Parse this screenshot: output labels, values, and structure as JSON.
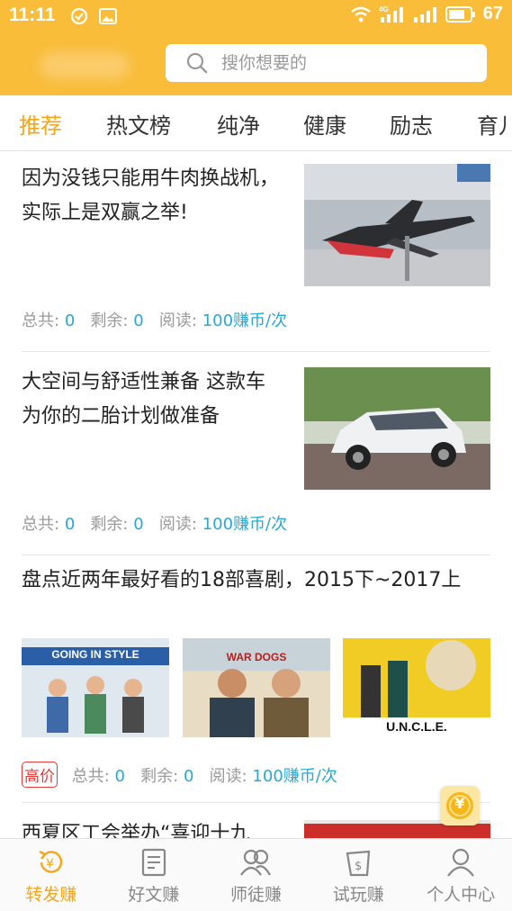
{
  "status_bar": {
    "time": "11:11",
    "network": "4G",
    "battery": "67"
  },
  "search": {
    "placeholder": "搜你想要的"
  },
  "tabs": [
    {
      "label": "推荐",
      "active": true
    },
    {
      "label": "热文榜"
    },
    {
      "label": "纯净"
    },
    {
      "label": "健康"
    },
    {
      "label": "励志"
    },
    {
      "label": "育儿"
    }
  ],
  "meta_labels": {
    "total": "总共:",
    "remain": "剩余:",
    "read": "阅读:"
  },
  "articles": [
    {
      "title": "因为没钱只能用牛肉换战机，实际上是双赢之举!",
      "total": "0",
      "remain": "0",
      "reward": "100赚币/次",
      "image": "fighter-jet-model"
    },
    {
      "title": "大空间与舒适性兼备 这款车为你的二胎计划做准备",
      "total": "0",
      "remain": "0",
      "reward": "100赚币/次",
      "image": "white-bmw-car"
    },
    {
      "title": "盘点近两年最好看的18部喜剧，2015下~2017上",
      "total": "0",
      "remain": "0",
      "reward": "100赚币/次",
      "badge": "高价",
      "posters": [
        {
          "caption": "GOING IN STYLE"
        },
        {
          "caption": "WAR DOGS"
        },
        {
          "caption": "U.N.C.L.E."
        }
      ]
    },
    {
      "title": "西夏区工会举办“喜迎十九",
      "image": "red-banner"
    }
  ],
  "floating_button": {
    "symbol": "¥"
  },
  "bottom_nav": [
    {
      "label": "转发赚",
      "icon": "yen-refresh-icon",
      "active": true
    },
    {
      "label": "好文赚",
      "icon": "article-icon"
    },
    {
      "label": "师徒赚",
      "icon": "people-icon"
    },
    {
      "label": "试玩赚",
      "icon": "cup-dollar-icon"
    },
    {
      "label": "个人中心",
      "icon": "person-icon"
    }
  ],
  "colors": {
    "accent": "#f9bd3a",
    "active_text": "#f6a619",
    "value_blue": "#2aa7d5",
    "badge_red": "#e5393a"
  }
}
